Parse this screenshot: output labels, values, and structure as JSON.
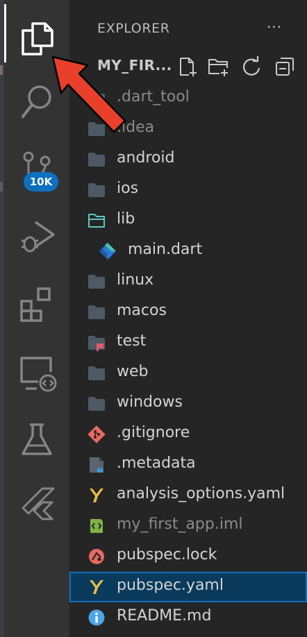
{
  "activity_bar": {
    "items": [
      {
        "name": "explorer",
        "icon": "files-icon"
      },
      {
        "name": "search",
        "icon": "search-icon"
      },
      {
        "name": "source-control",
        "icon": "source-control-icon",
        "badge": "10K"
      },
      {
        "name": "run-debug",
        "icon": "run-debug-icon"
      },
      {
        "name": "extensions",
        "icon": "extensions-icon"
      },
      {
        "name": "remote-explorer",
        "icon": "remote-explorer-icon"
      },
      {
        "name": "testing",
        "icon": "flask-icon"
      },
      {
        "name": "flutter",
        "icon": "flutter-icon"
      }
    ]
  },
  "sidebar": {
    "title": "EXPLORER",
    "more_label": "···",
    "project": {
      "name": "MY_FIR...",
      "actions": [
        "new-file-icon",
        "new-folder-icon",
        "refresh-icon",
        "collapse-all-icon"
      ]
    }
  },
  "tree": [
    {
      "label": ".dart_tool",
      "icon": "folder-icon",
      "dimmed": true
    },
    {
      "label": ".idea",
      "icon": "folder-icon",
      "dimmed": true
    },
    {
      "label": "android",
      "icon": "folder-icon"
    },
    {
      "label": "ios",
      "icon": "folder-icon"
    },
    {
      "label": "lib",
      "icon": "folder-open-icon"
    },
    {
      "label": "main.dart",
      "icon": "dart-icon",
      "indent": 1
    },
    {
      "label": "linux",
      "icon": "folder-icon"
    },
    {
      "label": "macos",
      "icon": "folder-icon"
    },
    {
      "label": "test",
      "icon": "folder-test-icon"
    },
    {
      "label": "web",
      "icon": "folder-icon"
    },
    {
      "label": "windows",
      "icon": "folder-icon"
    },
    {
      "label": ".gitignore",
      "icon": "git-icon"
    },
    {
      "label": ".metadata",
      "icon": "metadata-icon"
    },
    {
      "label": "analysis_options.yaml",
      "icon": "yaml-icon"
    },
    {
      "label": "my_first_app.iml",
      "icon": "iml-icon",
      "dimmed": true
    },
    {
      "label": "pubspec.lock",
      "icon": "lock-icon"
    },
    {
      "label": "pubspec.yaml",
      "icon": "yaml-icon",
      "selected": true
    },
    {
      "label": "README.md",
      "icon": "info-icon"
    }
  ],
  "colors": {
    "activity_bg": "#333333",
    "sidebar_bg": "#252526",
    "badge": "#0e70c0",
    "selection_border": "#0e70c0",
    "folder": "#4d5a66",
    "arrow": "#e8402a"
  },
  "annotation": {
    "type": "arrow",
    "target": "explorer-icon",
    "color": "#e8402a"
  }
}
